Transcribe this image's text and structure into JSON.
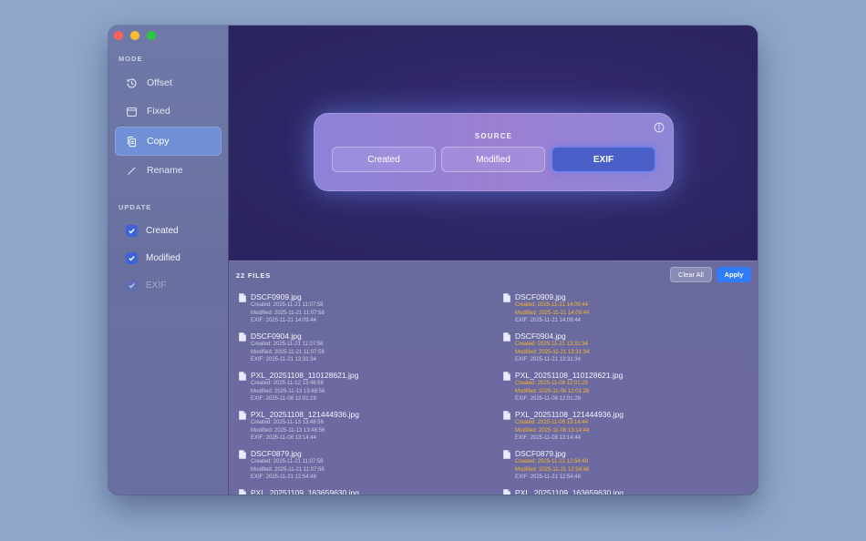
{
  "sidebar": {
    "mode_label": "MODE",
    "mode_items": [
      {
        "label": "Offset",
        "icon": "history-icon"
      },
      {
        "label": "Fixed",
        "icon": "calendar-icon"
      },
      {
        "label": "Copy",
        "icon": "copy-icon",
        "active": true
      },
      {
        "label": "Rename",
        "icon": "pencil-icon"
      }
    ],
    "update_label": "UPDATE",
    "update_items": [
      {
        "label": "Created",
        "checked": true,
        "enabled": true
      },
      {
        "label": "Modified",
        "checked": true,
        "enabled": true
      },
      {
        "label": "EXIF",
        "checked": true,
        "enabled": false
      }
    ]
  },
  "source": {
    "title": "SOURCE",
    "options": [
      "Created",
      "Modified",
      "EXIF"
    ],
    "selected": "EXIF"
  },
  "files": {
    "count_label": "22 FILES",
    "clear_label": "Clear All",
    "apply_label": "Apply",
    "before": [
      {
        "name": "DSCF0909.jpg",
        "created": "Created: 2025-11-21 11:07:58",
        "modified": "Modified: 2025-11-21 11:07:58",
        "exif": "EXIF: 2025-11-21 14:09:44"
      },
      {
        "name": "DSCF0904.jpg",
        "created": "Created: 2025-11-21 11:07:58",
        "modified": "Modified: 2025-11-21 11:07:58",
        "exif": "EXIF: 2025-11-21 13:31:34"
      },
      {
        "name": "PXL_20251108_110128621.jpg",
        "created": "Created: 2025-11-12 13:46:56",
        "modified": "Modified: 2025-11-13 13:48:56",
        "exif": "EXIF: 2025-11-08 12:01:28"
      },
      {
        "name": "PXL_20251108_121444936.jpg",
        "created": "Created: 2025-11-13 13:48:56",
        "modified": "Modified: 2025-11-13 13:48:56",
        "exif": "EXIF: 2025-11-08 13:14:44"
      },
      {
        "name": "DSCF0879.jpg",
        "created": "Created: 2025-11-21 11:07:58",
        "modified": "Modified: 2025-11-21 11:07:58",
        "exif": "EXIF: 2025-11-21 12:54:48"
      },
      {
        "name": "PXL_20251109_163659630.jpg",
        "created": "",
        "modified": "",
        "exif": ""
      }
    ],
    "after": [
      {
        "name": "DSCF0909.jpg",
        "created": "Created: 2025-11-21 14:09:44",
        "modified": "Modified: 2025-11-21 14:09:44",
        "exif": "EXIF: 2025-11-21 14:09:44"
      },
      {
        "name": "DSCF0904.jpg",
        "created": "Created: 2025-11-21 13:31:34",
        "modified": "Modified: 2025-11-21 13:31:34",
        "exif": "EXIF: 2025-11-21 13:31:34"
      },
      {
        "name": "PXL_20251108_110128621.jpg",
        "created": "Created: 2025-11-08 12:01:28",
        "modified": "Modified: 2025-11-08 12:01:28",
        "exif": "EXIF: 2025-11-08 12:01:28"
      },
      {
        "name": "PXL_20251108_121444936.jpg",
        "created": "Created: 2025-11-08 13:14:44",
        "modified": "Modified: 2025-11-08 13:14:44",
        "exif": "EXIF: 2025-11-08 13:14:44"
      },
      {
        "name": "DSCF0879.jpg",
        "created": "Created: 2025-11-21 12:54:48",
        "modified": "Modified: 2025-11-21 12:54:48",
        "exif": "EXIF: 2025-11-21 12:54:48"
      },
      {
        "name": "PXL_20251109_163659630.jpg",
        "created": "",
        "modified": "",
        "exif": ""
      }
    ]
  },
  "colors": {
    "accent": "#2f7cf6",
    "changed_value": "#f4b731",
    "sidebar_active": "#6f8fd6"
  }
}
